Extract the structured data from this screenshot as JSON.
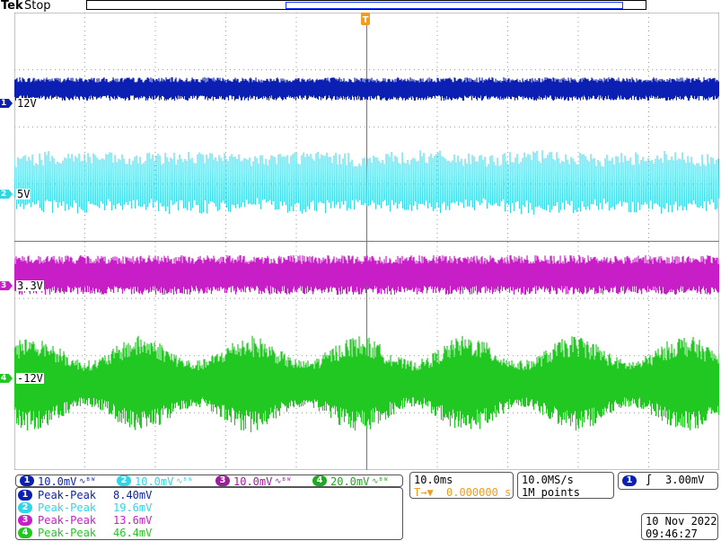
{
  "header": {
    "brand": "Tek",
    "status": "Stop"
  },
  "trigger_marker": {
    "top_label": "T",
    "level_label": "T"
  },
  "channels": [
    {
      "id": "1",
      "label": "12V",
      "color": "#0b1fb3"
    },
    {
      "id": "2",
      "label": "5V",
      "color": "#2fd6e6"
    },
    {
      "id": "3",
      "label": "3.3V",
      "color": "#c81ec8"
    },
    {
      "id": "4",
      "label": "-12V",
      "color": "#22c822"
    }
  ],
  "channel_scales": [
    {
      "num": "1",
      "text": "10.0mV",
      "coupling": "∿ᴮᵂ",
      "color": "#0b1fb3"
    },
    {
      "num": "2",
      "text": "10.0mV",
      "coupling": "∿ᴮᵂ",
      "color": "#2fd6e6"
    },
    {
      "num": "3",
      "text": "10.0mV",
      "coupling": "∿ᴮᵂ",
      "color": "#9b1e9b"
    },
    {
      "num": "4",
      "text": "20.0mV",
      "coupling": "∿ᴮᵂ",
      "color": "#22a822"
    }
  ],
  "timebase": {
    "scale": "10.0ms",
    "trigger_icon": "T→▼",
    "delay": "0.000000 s"
  },
  "acquisition": {
    "rate": "10.0MS/s",
    "points": "1M points"
  },
  "trigger": {
    "channel": "1",
    "slope_icon": "∫",
    "level": "3.00mV"
  },
  "measurements": [
    {
      "num": "1",
      "label": "Peak-Peak",
      "value": "8.40mV",
      "color": "#0b1fb3"
    },
    {
      "num": "2",
      "label": "Peak-Peak",
      "value": "19.6mV",
      "color": "#2fd6e6"
    },
    {
      "num": "3",
      "label": "Peak-Peak",
      "value": "13.6mV",
      "color": "#c81ec8"
    },
    {
      "num": "4",
      "label": "Peak-Peak",
      "value": "46.4mV",
      "color": "#22c822"
    }
  ],
  "datetime": {
    "date": "10 Nov 2022",
    "time": "09:46:27"
  }
}
